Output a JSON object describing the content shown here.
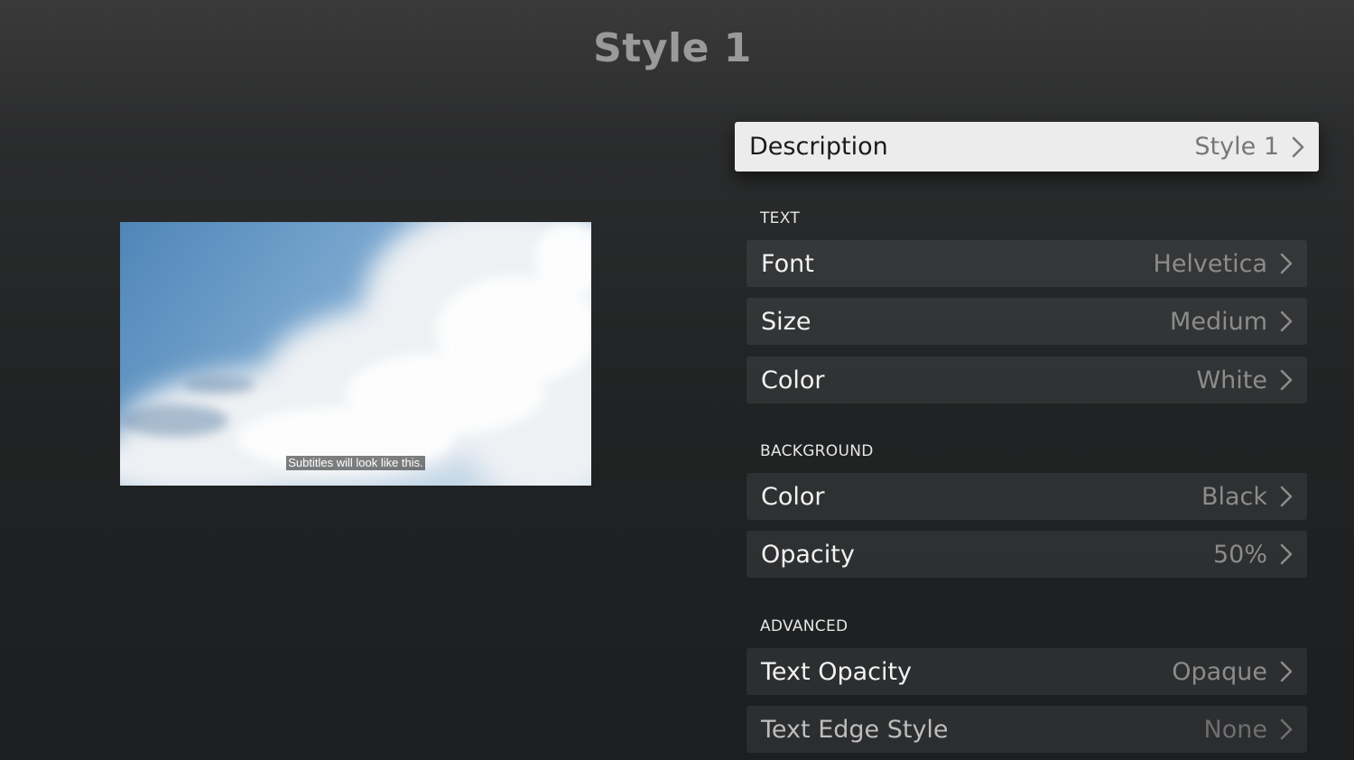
{
  "page": {
    "title": "Style 1"
  },
  "preview": {
    "subtitle_sample": "Subtitles will look like this."
  },
  "settings": {
    "description": {
      "label": "Description",
      "value": "Style 1"
    },
    "sections": {
      "text": {
        "header": "TEXT",
        "font": {
          "label": "Font",
          "value": "Helvetica"
        },
        "size": {
          "label": "Size",
          "value": "Medium"
        },
        "color": {
          "label": "Color",
          "value": "White"
        }
      },
      "background": {
        "header": "BACKGROUND",
        "color": {
          "label": "Color",
          "value": "Black"
        },
        "opacity": {
          "label": "Opacity",
          "value": "50%"
        }
      },
      "advanced": {
        "header": "ADVANCED",
        "text_opacity": {
          "label": "Text Opacity",
          "value": "Opaque"
        },
        "text_edge_style": {
          "label": "Text Edge Style",
          "value": "None"
        }
      }
    }
  },
  "icons": {
    "row_disclosure": "chevron-right-icon"
  },
  "colors": {
    "focused_row_bg": "#ececec",
    "row_bg": "#2e3031",
    "value_text": "#8c8c8c",
    "title_text": "#9a9a9a"
  }
}
